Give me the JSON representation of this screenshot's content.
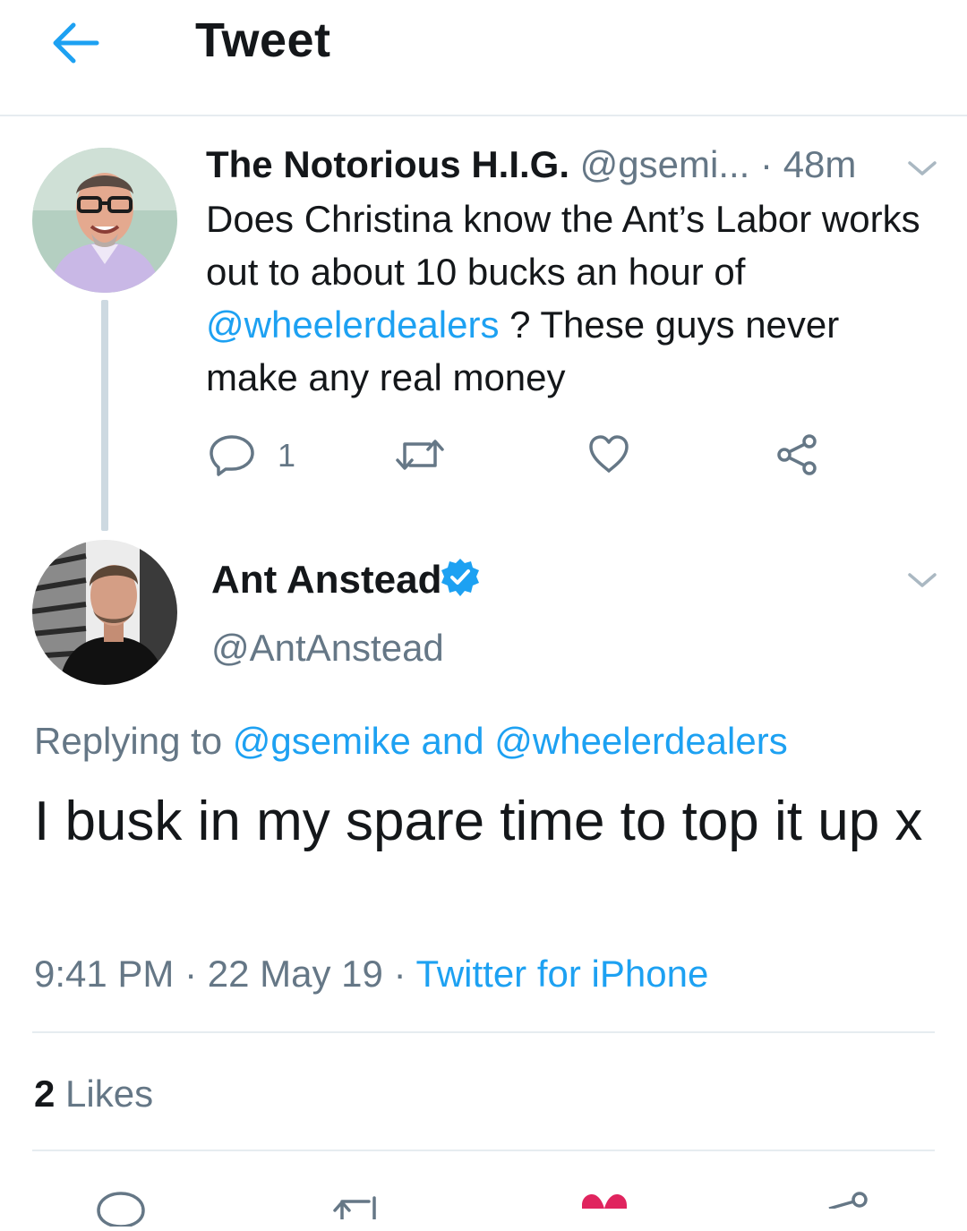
{
  "header": {
    "title": "Tweet"
  },
  "colors": {
    "accent": "#1da1f2",
    "muted": "#657786",
    "text": "#14171a",
    "like": "#e0245e",
    "divider": "#e6ecf0"
  },
  "parent_tweet": {
    "display_name": "The Notorious H.I.G.",
    "handle": "@gsemi...",
    "separator": "·",
    "time": "48m",
    "text_part1": "Does Christina know the Ant’s Labor works out to about 10 bucks an hour of ",
    "mention": "@wheelerdealers",
    "text_part2": " ? These guys never make any real money",
    "reply_count": "1",
    "icons": [
      "reply-icon",
      "retweet-icon",
      "like-icon",
      "share-icon"
    ]
  },
  "reply_tweet": {
    "display_name": "Ant Anstead",
    "handle": "@AntAnstead",
    "verified": true,
    "replying_prefix": "Replying to",
    "replying_user1": "@gsemike",
    "replying_and": "and",
    "replying_user2": "@wheelerdealers",
    "text": "I busk in my spare time to top it up x",
    "time": "9:41 PM",
    "separator1": "·",
    "date": "22 May 19",
    "separator2": "·",
    "source": "Twitter for iPhone",
    "likes_count": "2",
    "likes_label": "Likes"
  }
}
